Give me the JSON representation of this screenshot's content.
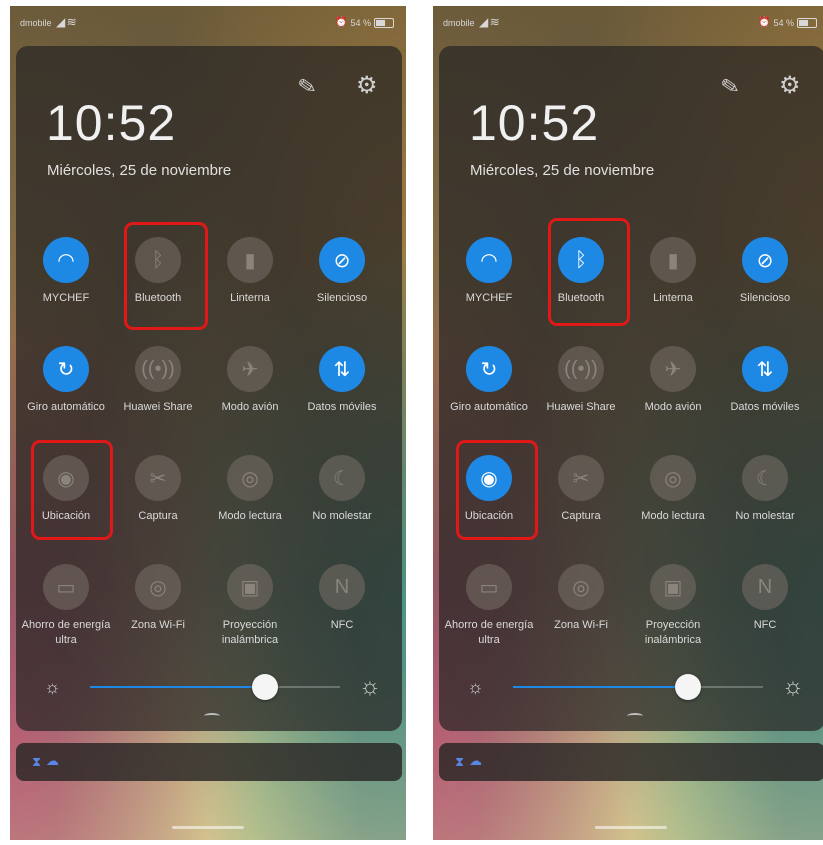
{
  "screens": [
    {
      "status": {
        "carrier": "dmobile",
        "battery": "54 %"
      },
      "time": "10:52",
      "date": "Miércoles, 25 de noviembre",
      "tiles": [
        {
          "label": "MYCHEF",
          "state": "on",
          "icon": "wifi-icon"
        },
        {
          "label": "Bluetooth",
          "state": "off",
          "icon": "bluetooth-icon"
        },
        {
          "label": "Linterna",
          "state": "off",
          "icon": "flashlight-icon"
        },
        {
          "label": "Silencioso",
          "state": "on",
          "icon": "silent-bell-icon"
        },
        {
          "label": "Giro automático",
          "state": "on",
          "icon": "auto-rotate-icon"
        },
        {
          "label": "Huawei Share",
          "state": "off",
          "icon": "huawei-share-icon"
        },
        {
          "label": "Modo avión",
          "state": "off",
          "icon": "airplane-icon"
        },
        {
          "label": "Datos móviles",
          "state": "on",
          "icon": "mobile-data-icon"
        },
        {
          "label": "Ubicación",
          "state": "off",
          "icon": "location-pin-icon"
        },
        {
          "label": "Captura",
          "state": "off",
          "icon": "screenshot-icon"
        },
        {
          "label": "Modo lectura",
          "state": "off",
          "icon": "eye-icon"
        },
        {
          "label": "No molestar",
          "state": "off",
          "icon": "moon-icon"
        },
        {
          "label": "Ahorro de energía ultra",
          "state": "off",
          "icon": "battery-saver-icon"
        },
        {
          "label": "Zona Wi-Fi",
          "state": "off",
          "icon": "hotspot-icon"
        },
        {
          "label": "Proyección inalámbrica",
          "state": "off",
          "icon": "wireless-projection-icon"
        },
        {
          "label": "NFC",
          "state": "off",
          "icon": "nfc-icon"
        }
      ],
      "brightness": 0.7
    },
    {
      "status": {
        "carrier": "dmobile",
        "battery": "54 %"
      },
      "time": "10:52",
      "date": "Miércoles, 25 de noviembre",
      "tiles": [
        {
          "label": "MYCHEF",
          "state": "on",
          "icon": "wifi-icon"
        },
        {
          "label": "Bluetooth",
          "state": "on",
          "icon": "bluetooth-icon"
        },
        {
          "label": "Linterna",
          "state": "off",
          "icon": "flashlight-icon"
        },
        {
          "label": "Silencioso",
          "state": "on",
          "icon": "silent-bell-icon"
        },
        {
          "label": "Giro automático",
          "state": "on",
          "icon": "auto-rotate-icon"
        },
        {
          "label": "Huawei Share",
          "state": "off",
          "icon": "huawei-share-icon"
        },
        {
          "label": "Modo avión",
          "state": "off",
          "icon": "airplane-icon"
        },
        {
          "label": "Datos móviles",
          "state": "on",
          "icon": "mobile-data-icon"
        },
        {
          "label": "Ubicación",
          "state": "on",
          "icon": "location-pin-icon"
        },
        {
          "label": "Captura",
          "state": "off",
          "icon": "screenshot-icon"
        },
        {
          "label": "Modo lectura",
          "state": "off",
          "icon": "eye-icon"
        },
        {
          "label": "No molestar",
          "state": "off",
          "icon": "moon-icon"
        },
        {
          "label": "Ahorro de energía ultra",
          "state": "off",
          "icon": "battery-saver-icon"
        },
        {
          "label": "Zona Wi-Fi",
          "state": "off",
          "icon": "hotspot-icon"
        },
        {
          "label": "Proyección inalámbrica",
          "state": "off",
          "icon": "wireless-projection-icon"
        },
        {
          "label": "NFC",
          "state": "off",
          "icon": "nfc-icon"
        }
      ],
      "brightness": 0.7
    }
  ],
  "colors": {
    "accent": "#1e88e5",
    "highlight": "#e01818"
  }
}
